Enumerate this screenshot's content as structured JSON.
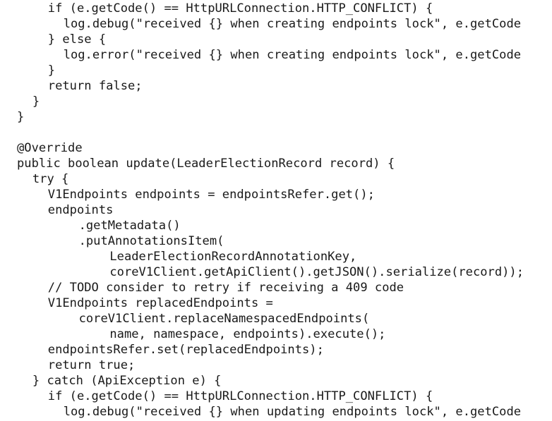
{
  "editor": {
    "lines": [
      {
        "indent": 4,
        "text": "if (e.getCode() == HttpURLConnection.HTTP_CONFLICT) {"
      },
      {
        "indent": 6,
        "text": "log.debug(\"received {} when creating endpoints lock\", e.getCode"
      },
      {
        "indent": 4,
        "text": "} else {"
      },
      {
        "indent": 6,
        "text": "log.error(\"received {} when creating endpoints lock\", e.getCode"
      },
      {
        "indent": 4,
        "text": "}"
      },
      {
        "indent": 4,
        "text": "return false;"
      },
      {
        "indent": 2,
        "text": "}"
      },
      {
        "indent": 0,
        "text": "}"
      },
      {
        "indent": 0,
        "text": ""
      },
      {
        "indent": 0,
        "text": "@Override"
      },
      {
        "indent": 0,
        "text": "public boolean update(LeaderElectionRecord record) {"
      },
      {
        "indent": 2,
        "text": "try {"
      },
      {
        "indent": 4,
        "text": "V1Endpoints endpoints = endpointsRefer.get();"
      },
      {
        "indent": 4,
        "text": "endpoints"
      },
      {
        "indent": 8,
        "text": ".getMetadata()"
      },
      {
        "indent": 8,
        "text": ".putAnnotationsItem("
      },
      {
        "indent": 12,
        "text": "LeaderElectionRecordAnnotationKey,"
      },
      {
        "indent": 12,
        "text": "coreV1Client.getApiClient().getJSON().serialize(record));"
      },
      {
        "indent": 4,
        "text": "// TODO consider to retry if receiving a 409 code"
      },
      {
        "indent": 4,
        "text": "V1Endpoints replacedEndpoints ="
      },
      {
        "indent": 8,
        "text": "coreV1Client.replaceNamespacedEndpoints("
      },
      {
        "indent": 12,
        "text": "name, namespace, endpoints).execute();"
      },
      {
        "indent": 4,
        "text": "endpointsRefer.set(replacedEndpoints);"
      },
      {
        "indent": 4,
        "text": "return true;"
      },
      {
        "indent": 2,
        "text": "} catch (ApiException e) {"
      },
      {
        "indent": 4,
        "text": "if (e.getCode() == HttpURLConnection.HTTP_CONFLICT) {"
      },
      {
        "indent": 6,
        "text": "log.debug(\"received {} when updating endpoints lock\", e.getCode"
      }
    ]
  }
}
